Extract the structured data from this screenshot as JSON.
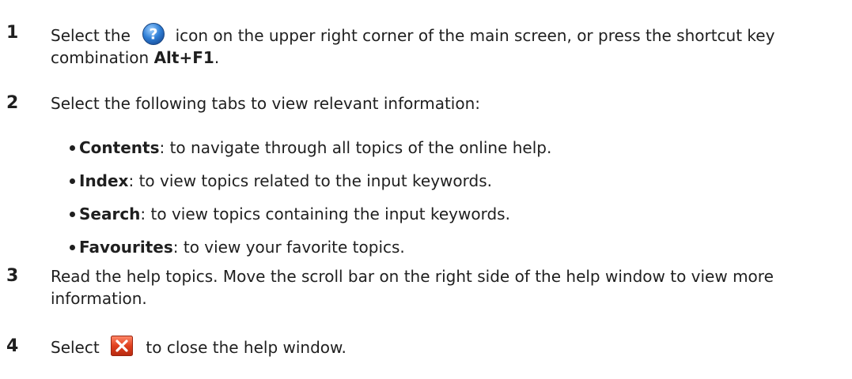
{
  "steps": [
    {
      "number": "1",
      "pre_icon": "Select the",
      "icon": "help-icon",
      "post_icon": "icon on the upper right corner of the main screen, or press the shortcut key",
      "line2_pre": "combination ",
      "shortcut": "Alt+F1",
      "line2_post": "."
    },
    {
      "number": "2",
      "text": "Select the following tabs to view relevant information:"
    },
    {
      "number": "3",
      "line1": "Read the help topics. Move the scroll bar on the right side of the help window to view more",
      "line2": "information."
    },
    {
      "number": "4",
      "pre_icon": "Select",
      "icon": "close-icon",
      "post_icon": "to close the help window."
    }
  ],
  "tabs": [
    {
      "name": "Contents",
      "desc": ": to navigate through all topics of the online help."
    },
    {
      "name": "Index",
      "desc": ": to view topics related to the input keywords."
    },
    {
      "name": "Search",
      "desc": ": to view topics containing the input keywords."
    },
    {
      "name": "Favourites",
      "desc": ": to view your favorite topics."
    }
  ],
  "colors": {
    "help_icon_fill": "#2f7fd6",
    "close_icon_fill": "#e0401f"
  }
}
